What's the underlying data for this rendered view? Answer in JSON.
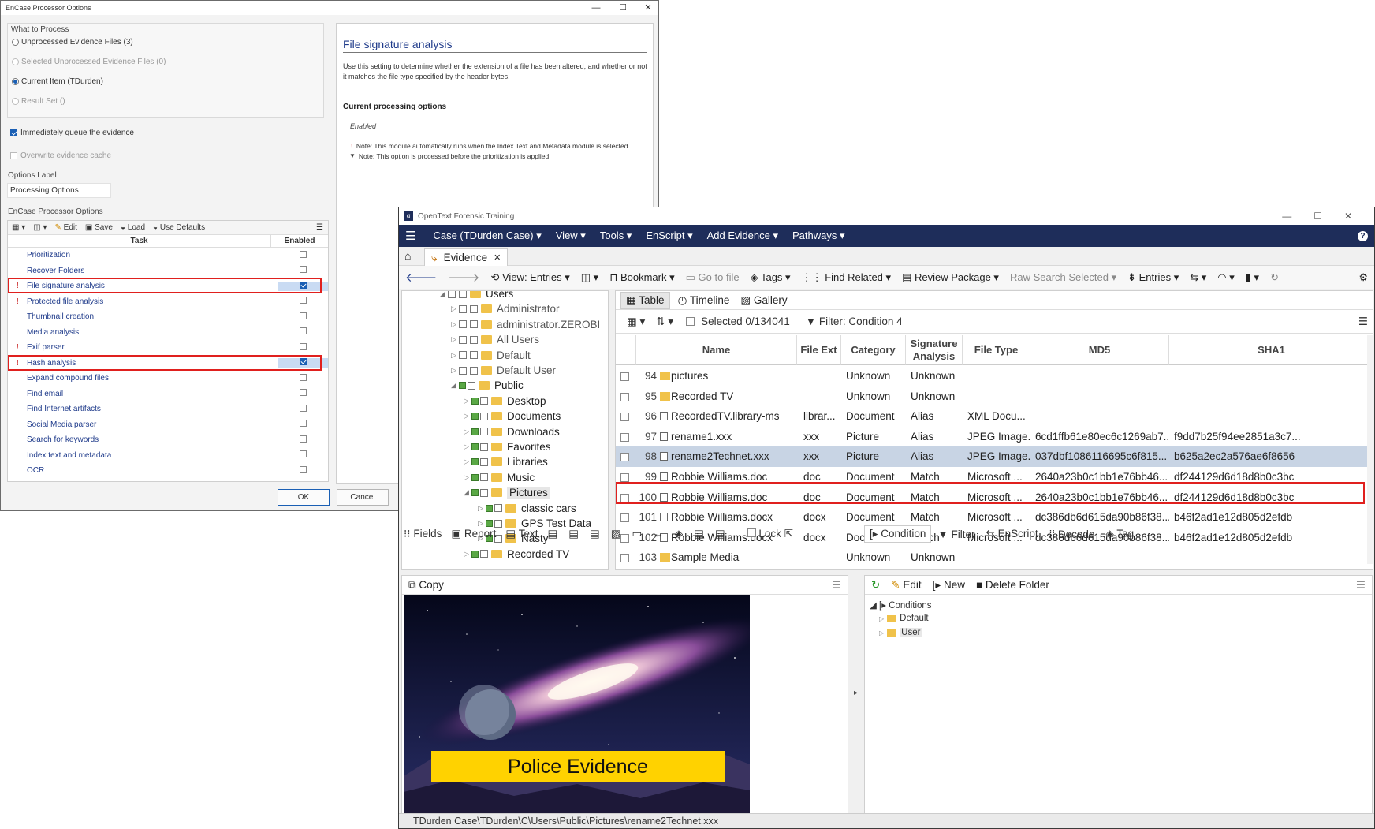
{
  "dialog": {
    "title": "EnCase Processor Options",
    "what_to_process": "What to Process",
    "radios": [
      {
        "label": "Unprocessed Evidence Files (3)",
        "enabled": true,
        "selected": false
      },
      {
        "label": "Selected Unprocessed Evidence Files (0)",
        "enabled": false,
        "selected": false
      },
      {
        "label": "Current Item (TDurden)",
        "enabled": true,
        "selected": true
      },
      {
        "label": "Result Set ()",
        "enabled": false,
        "selected": false
      }
    ],
    "queue_label": "Immediately queue the evidence",
    "overwrite_label": "Overwrite evidence cache",
    "options_label_caption": "Options Label",
    "options_label_value": "Processing Options",
    "processor_options_caption": "EnCase Processor Options",
    "toolbar": {
      "edit": "Edit",
      "save": "Save",
      "load": "Load",
      "use_defaults": "Use Defaults"
    },
    "columns": {
      "task": "Task",
      "enabled": "Enabled"
    },
    "tasks": [
      {
        "name": "Prioritization",
        "flag": false,
        "checked": false
      },
      {
        "name": "Recover Folders",
        "flag": false,
        "checked": false
      },
      {
        "name": "File signature analysis",
        "flag": true,
        "checked": true
      },
      {
        "name": "Protected file analysis",
        "flag": true,
        "checked": false
      },
      {
        "name": "Thumbnail creation",
        "flag": false,
        "checked": false
      },
      {
        "name": "Media analysis",
        "flag": false,
        "checked": false
      },
      {
        "name": "Exif parser",
        "flag": true,
        "checked": false
      },
      {
        "name": "Hash analysis",
        "flag": true,
        "checked": true
      },
      {
        "name": "Expand compound files",
        "flag": false,
        "checked": false
      },
      {
        "name": "Find email",
        "flag": false,
        "checked": false
      },
      {
        "name": "Find Internet artifacts",
        "flag": false,
        "checked": false
      },
      {
        "name": "Social Media parser",
        "flag": false,
        "checked": false
      },
      {
        "name": "Search for keywords",
        "flag": false,
        "checked": false
      },
      {
        "name": "Index text and metadata",
        "flag": false,
        "checked": false
      },
      {
        "name": "OCR",
        "flag": false,
        "checked": false
      }
    ],
    "desc": {
      "heading": "File signature analysis",
      "body": "Use this setting to determine whether the extension of a file has been altered, and whether or not it matches the file type specified by the header bytes.",
      "current_heading": "Current processing options",
      "status": "Enabled",
      "note1": "Note: This module automatically runs when the Index Text and Metadata module is selected.",
      "note2": "Note: This option is processed before the prioritization is applied."
    },
    "ok": "OK",
    "cancel": "Cancel",
    "accent": "#1a5fb4",
    "highlight": "#e0201e"
  },
  "encase": {
    "title": "OpenText Forensic Training",
    "menu": [
      "Case (TDurden Case) ▾",
      "View ▾",
      "Tools ▾",
      "EnScript ▾",
      "Add Evidence ▾",
      "Pathways ▾"
    ],
    "tab": "Evidence",
    "toolbar": [
      "View: Entries ▾",
      "Bookmark ▾",
      "Go to file",
      "Tags ▾",
      "Find Related ▾",
      "Review Package ▾",
      "Raw Search Selected ▾",
      "Entries ▾"
    ],
    "tree": [
      {
        "label": "Users",
        "indent": 0,
        "green": false
      },
      {
        "label": "Administrator",
        "indent": 1,
        "green": false
      },
      {
        "label": "administrator.ZEROBI",
        "indent": 1,
        "green": false
      },
      {
        "label": "All Users",
        "indent": 1,
        "green": false
      },
      {
        "label": "Default",
        "indent": 1,
        "green": false
      },
      {
        "label": "Default User",
        "indent": 1,
        "green": false
      },
      {
        "label": "Public",
        "indent": 1,
        "green": true
      },
      {
        "label": "Desktop",
        "indent": 2,
        "green": true
      },
      {
        "label": "Documents",
        "indent": 2,
        "green": true
      },
      {
        "label": "Downloads",
        "indent": 2,
        "green": true
      },
      {
        "label": "Favorites",
        "indent": 2,
        "green": true
      },
      {
        "label": "Libraries",
        "indent": 2,
        "green": true
      },
      {
        "label": "Music",
        "indent": 2,
        "green": true
      },
      {
        "label": "Pictures",
        "indent": 2,
        "green": true
      },
      {
        "label": "classic cars",
        "indent": 3,
        "green": true
      },
      {
        "label": "GPS Test Data",
        "indent": 3,
        "green": true
      },
      {
        "label": "Nasty",
        "indent": 3,
        "green": true
      },
      {
        "label": "Recorded TV",
        "indent": 2,
        "green": true
      }
    ],
    "view_tabs": {
      "table": "Table",
      "timeline": "Timeline",
      "gallery": "Gallery"
    },
    "selected": "Selected 0/134041",
    "filter": "Filter: Condition 4",
    "columns": [
      "Name",
      "File Ext",
      "Category",
      "Signature Analysis",
      "File Type",
      "MD5",
      "SHA1"
    ],
    "rows": [
      {
        "n": "94",
        "name": "pictures",
        "ext": "",
        "cat": "Unknown",
        "sig": "Unknown",
        "type": "",
        "md5": "",
        "sha1": "",
        "icon": "folder"
      },
      {
        "n": "95",
        "name": "Recorded TV",
        "ext": "",
        "cat": "Unknown",
        "sig": "Unknown",
        "type": "",
        "md5": "",
        "sha1": "",
        "icon": "folder"
      },
      {
        "n": "96",
        "name": "RecordedTV.library-ms",
        "ext": "librar...",
        "cat": "Document",
        "sig": "Alias",
        "type": "XML Docu...",
        "md5": "",
        "sha1": "",
        "icon": "file"
      },
      {
        "n": "97",
        "name": "rename1.xxx",
        "ext": "xxx",
        "cat": "Picture",
        "sig": "Alias",
        "type": "JPEG Image...",
        "md5": "6cd1ffb61e80ec6c1269ab7...",
        "sha1": "f9dd7b25f94ee2851a3c7...",
        "icon": "img"
      },
      {
        "n": "98",
        "name": "rename2Technet.xxx",
        "ext": "xxx",
        "cat": "Picture",
        "sig": "Alias",
        "type": "JPEG Image...",
        "md5": "037dbf1086116695c6f815...",
        "sha1": "b625a2ec2a576ae6f8656",
        "icon": "img"
      },
      {
        "n": "99",
        "name": "Robbie Williams.doc",
        "ext": "doc",
        "cat": "Document",
        "sig": "Match",
        "type": "Microsoft ...",
        "md5": "2640a23b0c1bb1e76bb46...",
        "sha1": "df244129d6d18d8b0c3bc",
        "icon": "file"
      },
      {
        "n": "100",
        "name": "Robbie Williams.doc",
        "ext": "doc",
        "cat": "Document",
        "sig": "Match",
        "type": "Microsoft ...",
        "md5": "2640a23b0c1bb1e76bb46...",
        "sha1": "df244129d6d18d8b0c3bc",
        "icon": "file"
      },
      {
        "n": "101",
        "name": "Robbie Williams.docx",
        "ext": "docx",
        "cat": "Document",
        "sig": "Match",
        "type": "Microsoft ...",
        "md5": "dc386db6d615da90b86f38...",
        "sha1": "b46f2ad1e12d805d2efdb",
        "icon": "file"
      },
      {
        "n": "102",
        "name": "Robbie Williams.docx",
        "ext": "docx",
        "cat": "Document",
        "sig": "Match",
        "type": "Microsoft ...",
        "md5": "dc386db6d615da90b86f38...",
        "sha1": "b46f2ad1e12d805d2efdb",
        "icon": "file"
      },
      {
        "n": "103",
        "name": "Sample Media",
        "ext": "",
        "cat": "Unknown",
        "sig": "Unknown",
        "type": "",
        "md5": "",
        "sha1": "",
        "icon": "folder"
      }
    ],
    "bottom_tabs": [
      "Fields",
      "Report",
      "Text",
      "Lock"
    ],
    "copy": "Copy",
    "image_caption": "Police Evidence",
    "cond_tabs": [
      "Condition",
      "Filter",
      "EnScript",
      "Decode",
      "Tag"
    ],
    "cond_toolbar": [
      "Edit",
      "New",
      "Delete Folder"
    ],
    "cond_tree": [
      "Conditions",
      "Default",
      "User"
    ],
    "status": "TDurden Case\\TDurden\\C\\Users\\Public\\Pictures\\rename2Technet.xxx",
    "brand": "#1e2d5a",
    "selected_row_color": "#c8d4e4"
  }
}
